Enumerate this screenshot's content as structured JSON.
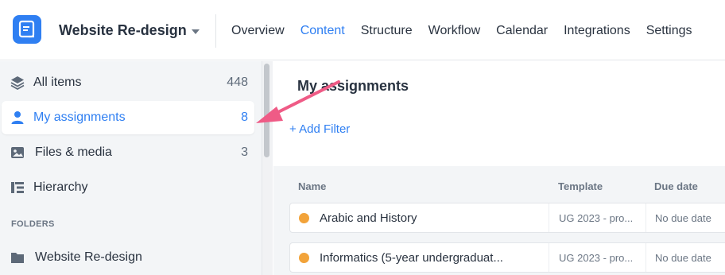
{
  "topbar": {
    "project_name": "Website Re-design",
    "tabs": [
      {
        "label": "Overview"
      },
      {
        "label": "Content"
      },
      {
        "label": "Structure"
      },
      {
        "label": "Workflow"
      },
      {
        "label": "Calendar"
      },
      {
        "label": "Integrations"
      },
      {
        "label": "Settings"
      }
    ],
    "active_tab": "Content",
    "accent_color": "#2f7ff2"
  },
  "sidebar": {
    "items": [
      {
        "label": "All items",
        "count": "448",
        "icon": "layers-icon"
      },
      {
        "label": "My assignments",
        "count": "8",
        "icon": "user-icon",
        "active": true
      },
      {
        "label": "Files & media",
        "count": "3",
        "icon": "image-icon"
      },
      {
        "label": "Hierarchy",
        "count": "",
        "icon": "hierarchy-icon"
      }
    ],
    "folders_title": "FOLDERS",
    "folders": [
      {
        "label": "Website Re-design",
        "icon": "folder-icon"
      }
    ]
  },
  "main": {
    "title": "My assignments",
    "add_filter": "+ Add Filter",
    "columns": {
      "name": "Name",
      "template": "Template",
      "due": "Due date"
    },
    "rows": [
      {
        "name": "Arabic and History",
        "template": "UG 2023 - pro...",
        "due": "No due date",
        "status_color": "#f2a33a"
      },
      {
        "name": "Informatics (5-year undergraduat...",
        "template": "UG 2023 - pro...",
        "due": "No due date",
        "status_color": "#f2a33a"
      }
    ]
  },
  "annotation": {
    "arrow_color": "#ef5b86"
  }
}
